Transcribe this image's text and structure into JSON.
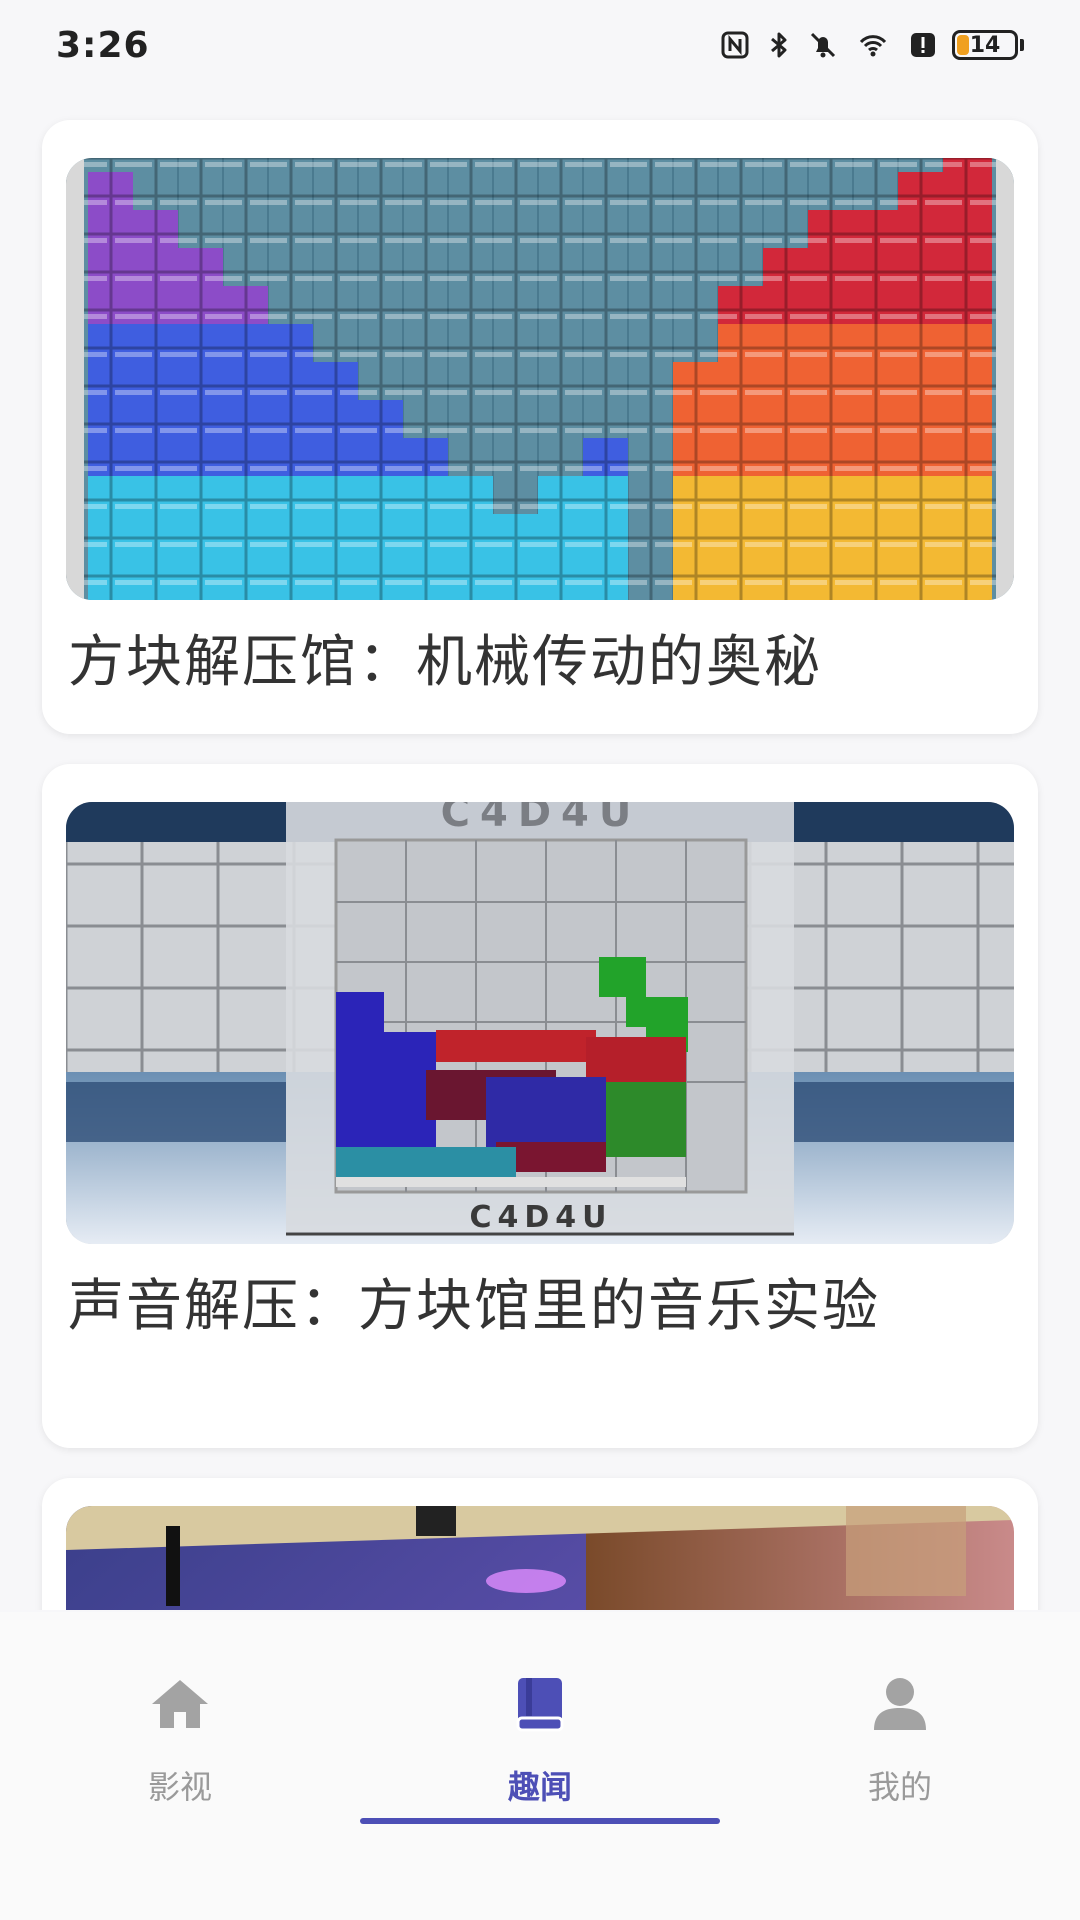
{
  "status": {
    "time": "3:26",
    "battery": "14",
    "icons": [
      "nfc-icon",
      "bluetooth-icon",
      "mute-icon",
      "wifi-icon",
      "alert-icon",
      "battery-icon"
    ]
  },
  "feed": {
    "items": [
      {
        "title": "方块解压馆：机械传动的奥秘",
        "image": "tetris-blocks-colorful"
      },
      {
        "title": "声音解压：方块馆里的音乐实验",
        "image": "tetris-glass-c4d4u",
        "image_text": "C4D4U"
      },
      {
        "title": "",
        "image": "concert-stage"
      }
    ]
  },
  "nav": {
    "items": [
      {
        "label": "影视",
        "icon": "home-icon",
        "active": false
      },
      {
        "label": "趣闻",
        "icon": "book-icon",
        "active": true
      },
      {
        "label": "我的",
        "icon": "person-icon",
        "active": false
      }
    ],
    "accent_color": "#4d4fb6",
    "inactive_color": "#9a9a9a"
  }
}
